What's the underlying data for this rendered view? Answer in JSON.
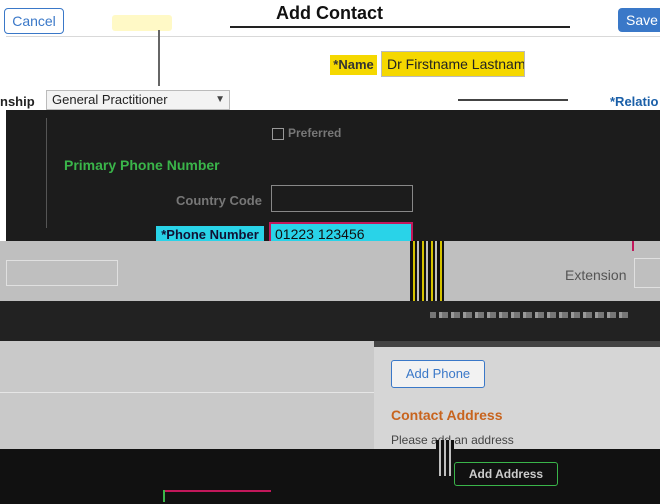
{
  "header": {
    "cancel_label": "Cancel",
    "title": "Add Contact",
    "save_label": "Save"
  },
  "name_row": {
    "label": "*Name",
    "value": "Dr Firstname Lastname"
  },
  "relationship_row": {
    "left_label_fragment": "nship",
    "selected_value": "General Practitioner",
    "right_label_fragment": "*Relatio"
  },
  "phone_modal": {
    "preferred_label": "Preferred",
    "preferred_checked": false,
    "section_title": "Primary Phone Number",
    "country_code_label": "Country Code",
    "country_code_value": "",
    "phone_number_label": "*Phone Number",
    "phone_number_value": "01223 123456"
  },
  "phone_section": {
    "extension_label": "Extension",
    "extension_value": "",
    "add_phone_label": "Add Phone"
  },
  "address_section": {
    "title": "Contact Address",
    "hint": "Please add an address",
    "add_address_label": "Add Address"
  },
  "colors": {
    "accent_blue": "#3a78c8",
    "highlight_yellow": "#f5d800",
    "highlight_cyan": "#29d3e8",
    "section_green": "#3ab54a",
    "address_orange": "#c8641e"
  }
}
